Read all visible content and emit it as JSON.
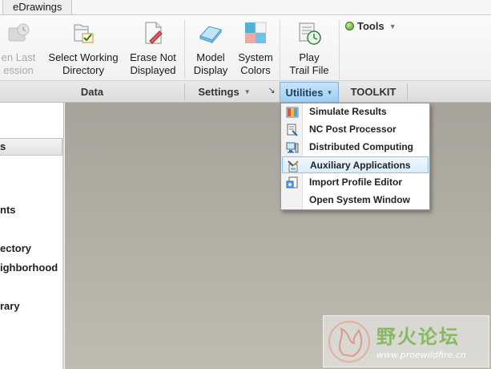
{
  "tabstrip": {
    "tab_label": "eDrawings"
  },
  "ribbon": {
    "buttons": [
      {
        "label": "en Last\nession",
        "icon": "open-last-session-icon",
        "disabled": true
      },
      {
        "label": "Select Working\nDirectory",
        "icon": "folder-check-icon"
      },
      {
        "label": "Erase Not\nDisplayed",
        "icon": "erase-doc-icon"
      },
      {
        "label": "Model\nDisplay",
        "icon": "model-display-icon"
      },
      {
        "label": "System\nColors",
        "icon": "system-colors-icon"
      },
      {
        "label": "Play\nTrail File",
        "icon": "play-trail-file-icon"
      }
    ],
    "tools": {
      "label": "Tools",
      "icon": "green-dot-icon"
    }
  },
  "groups": {
    "data": "Data",
    "settings": "Settings",
    "utilities": "Utilities",
    "toolkit": "TOOLKIT"
  },
  "left_panel": {
    "header": "s",
    "items": [
      "nts",
      "ectory",
      "ighborhood",
      "rary"
    ]
  },
  "utilities_menu": {
    "items": [
      {
        "label": "Simulate Results",
        "icon": "simulate-results-icon"
      },
      {
        "label": "NC Post Processor",
        "icon": "nc-post-processor-icon"
      },
      {
        "label": "Distributed Computing",
        "icon": "distributed-computing-icon"
      },
      {
        "label": "Auxiliary Applications",
        "icon": "auxiliary-applications-icon",
        "highlighted": true
      },
      {
        "label": "Import Profile Editor",
        "icon": "import-profile-editor-icon"
      },
      {
        "label": "Open System Window",
        "icon": "open-system-window-icon"
      }
    ]
  },
  "watermark": {
    "title": "野火论坛",
    "url": "www.proewildfire.cn"
  },
  "colors": {
    "canvas": "#aeaaa0",
    "accent": "#9fcdf2",
    "hover": "#dbeefc"
  }
}
